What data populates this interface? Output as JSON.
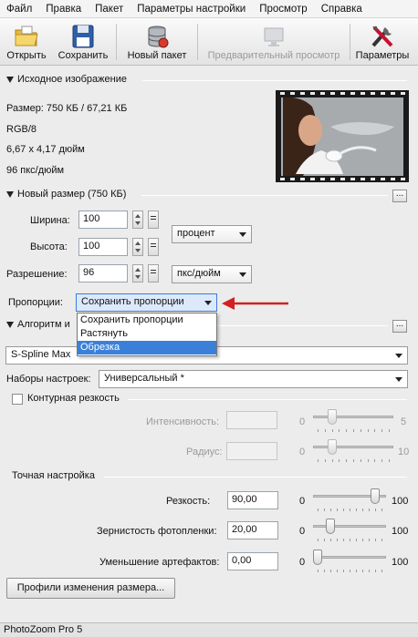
{
  "menu": [
    "Файл",
    "Правка",
    "Пакет",
    "Параметры настройки",
    "Просмотр",
    "Справка"
  ],
  "toolbar": {
    "open": "Открыть",
    "save": "Сохранить",
    "batch": "Новый пакет",
    "preview": "Предварительный просмотр",
    "settings": "Параметры"
  },
  "source": {
    "title": "Исходное изображение",
    "size": "Размер: 750 КБ / 67,21 КБ",
    "mode": "RGB/8",
    "dimensions": "6,67 x 4,17 дюйм",
    "resolution": "96 пкс/дюйм"
  },
  "newsize": {
    "title": "Новый размер (750 КБ)",
    "width_label": "Ширина:",
    "width_value": "100",
    "height_label": "Высота:",
    "height_value": "100",
    "unit_percent": "процент",
    "res_label": "Разрешение:",
    "res_value": "96",
    "unit_res": "пкс/дюйм",
    "prop_label": "Пропорции:",
    "prop_value": "Сохранить пропорции",
    "prop_options": [
      "Сохранить пропорции",
      "Растянуть",
      "Обрезка"
    ],
    "prop_highlighted": "Обрезка",
    "dots": "..."
  },
  "algorithm": {
    "title": "Алгоритм и",
    "value": "S-Spline Max",
    "presets_label": "Наборы настроек:",
    "presets_value": "Универсальный *",
    "dots": "..."
  },
  "sharp": {
    "check_label": "Контурная резкость",
    "intensity_label": "Интенсивность:",
    "intensity_min": "0",
    "intensity_max": "5",
    "intensity_level": 0.2,
    "radius_label": "Радиус:",
    "radius_min": "0",
    "radius_max": "10",
    "radius_level": 0.2
  },
  "fine": {
    "title": "Точная настройка",
    "sharpness_label": "Резкость:",
    "sharpness_value": "90,00",
    "sharpness_min": "0",
    "sharpness_max": "100",
    "sharpness_level": 0.9,
    "grain_label": "Зернистость фотопленки:",
    "grain_value": "20,00",
    "grain_min": "0",
    "grain_max": "100",
    "grain_level": 0.2,
    "artifacts_label": "Уменьшение артефактов:",
    "artifacts_value": "0,00",
    "artifacts_min": "0",
    "artifacts_max": "100",
    "artifacts_level": 0.0
  },
  "profiles_button": "Профили изменения размера...",
  "status": "PhotoZoom Pro 5",
  "colors": {
    "accent": "#3b80d8",
    "arrow": "#d42020"
  }
}
